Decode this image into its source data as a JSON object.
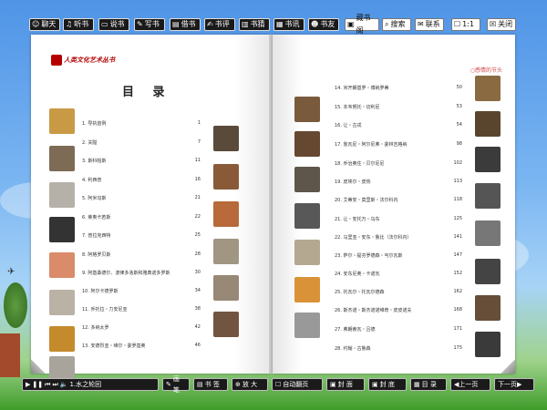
{
  "top_left_buttons": [
    {
      "icon": "chat-icon",
      "label": "聊天"
    },
    {
      "icon": "listen-icon",
      "label": "听书"
    },
    {
      "icon": "tell-icon",
      "label": "说书"
    },
    {
      "icon": "write-icon",
      "label": "写书"
    },
    {
      "icon": "borrow-icon",
      "label": "借书"
    },
    {
      "icon": "review-icon",
      "label": "书评"
    },
    {
      "icon": "guess-icon",
      "label": "书猜"
    },
    {
      "icon": "news-icon",
      "label": "书讯"
    },
    {
      "icon": "friends-icon",
      "label": "书友"
    }
  ],
  "top_right_buttons": [
    {
      "icon": "library-icon",
      "label": "藏书阁"
    },
    {
      "icon": "search-icon",
      "label": "搜索"
    },
    {
      "icon": "contact-icon",
      "label": "联系"
    },
    {
      "icon": "zoom-icon",
      "label": "1:1"
    },
    {
      "icon": "close-icon",
      "label": "关闭"
    }
  ],
  "book": {
    "series": "人类文化艺术丛书",
    "page_title": "目 录",
    "left_entries": [
      {
        "n": "1.",
        "t": "导执首例",
        "p": "1"
      },
      {
        "n": "2.",
        "t": "关隘",
        "p": "7"
      },
      {
        "n": "3.",
        "t": "斯科帕斯",
        "p": "11"
      },
      {
        "n": "4.",
        "t": "利西普",
        "p": "16"
      },
      {
        "n": "5.",
        "t": "阿米勾斯",
        "p": "21"
      },
      {
        "n": "6.",
        "t": "莱奥卡若斯",
        "p": "22"
      },
      {
        "n": "7.",
        "t": "普拉克西特",
        "p": "25"
      },
      {
        "n": "8.",
        "t": "阿格罗贝斯",
        "p": "28"
      },
      {
        "n": "9.",
        "t": "阿基桑德尔、波律多洛斯和雅典诺多罗斯",
        "p": "30"
      },
      {
        "n": "10.",
        "t": "阿尔卡德罗斯",
        "p": "34"
      },
      {
        "n": "11.",
        "t": "乔托拉・力安尼亚",
        "p": "38"
      },
      {
        "n": "12.",
        "t": "多纳太罗",
        "p": "42"
      },
      {
        "n": "13.",
        "t": "安德烈亚・维尔・委罗基奥",
        "p": "46"
      }
    ],
    "right_ribbon": "○感情的节头",
    "right_entries": [
      {
        "n": "14.",
        "t": "米开朗基罗・博纳罗蒂",
        "p": "50"
      },
      {
        "n": "15.",
        "t": "本韦努托・切利尼",
        "p": "53"
      },
      {
        "n": "16.",
        "t": "让・古戎",
        "p": "54"
      },
      {
        "n": "17.",
        "t": "詹瓦尼・阿尔尼弗・委林吉格纳",
        "p": "98"
      },
      {
        "n": "18.",
        "t": "乔治奥住・贝尔尼尼",
        "p": "102"
      },
      {
        "n": "19.",
        "t": "皮埃尔・皮热",
        "p": "113"
      },
      {
        "n": "20.",
        "t": "艾蒂安・莫里斯・法尔科内",
        "p": "118"
      },
      {
        "n": "21.",
        "t": "让・安托万・乌东",
        "p": "125"
      },
      {
        "n": "22.",
        "t": "马里亚・安东・鲁比（法尔科内）",
        "p": "141"
      },
      {
        "n": "23.",
        "t": "萨尔・提芬罗德森・丐尔瓦斯",
        "p": "147"
      },
      {
        "n": "24.",
        "t": "安东尼奥・卡诺瓦",
        "p": "152"
      },
      {
        "n": "25.",
        "t": "托瓦尔・托瓦尔德森",
        "p": "162"
      },
      {
        "n": "26.",
        "t": "斯杰诺・斯杰诺诺维奇・皮皮诺夫",
        "p": "168"
      },
      {
        "n": "27.",
        "t": "弗朗索瓦・吕德",
        "p": "171"
      },
      {
        "n": "28.",
        "t": "约翰・古鲁森",
        "p": "175"
      }
    ]
  },
  "bottom": {
    "player_label": "1.水之轮回",
    "buttons": [
      {
        "icon": "pen-icon",
        "label": "画 笔"
      },
      {
        "icon": "bookmark-icon",
        "label": "书 签"
      },
      {
        "icon": "zoom-in-icon",
        "label": "放 大"
      },
      {
        "icon": "auto-flip-icon",
        "label": "自动翻页"
      },
      {
        "icon": "cover-icon",
        "label": "封 面"
      },
      {
        "icon": "back-cover-icon",
        "label": "封 底"
      },
      {
        "icon": "contents-icon",
        "label": "目 录"
      },
      {
        "icon": "prev-icon",
        "label": "◀上一页"
      },
      {
        "icon": "next-icon",
        "label": "下一页▶"
      }
    ]
  },
  "colors": {
    "accent": "#b40000",
    "toolbar": "#1a1a1a"
  }
}
